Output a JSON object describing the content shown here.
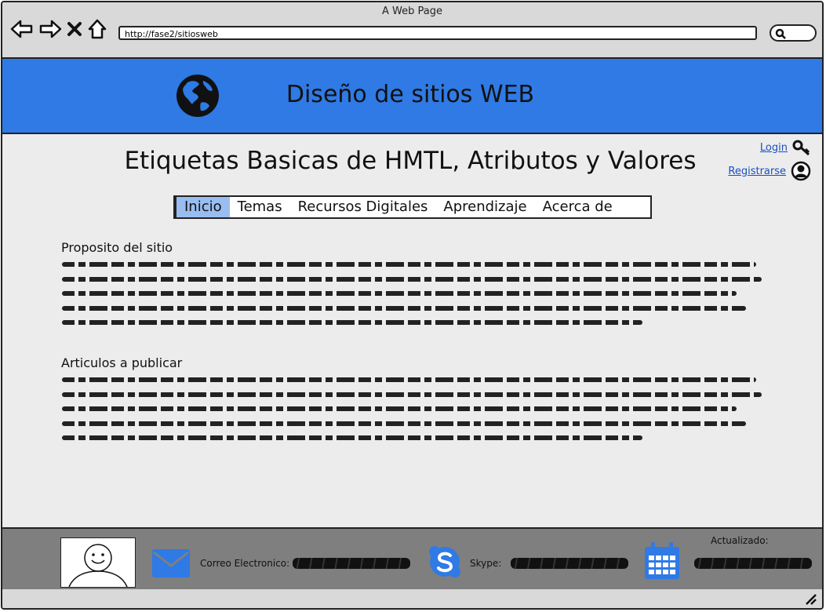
{
  "browser": {
    "window_title": "A Web Page",
    "url": "http://fase2/sitiosweb"
  },
  "header": {
    "site_title": "Diseño de sitios WEB"
  },
  "main": {
    "page_title": "Etiquetas Basicas de HMTL, Atributos y Valores",
    "auth": {
      "login_label": "Login",
      "register_label": "Registrarse"
    },
    "menu": [
      {
        "label": "Inicio",
        "active": true
      },
      {
        "label": "Temas",
        "active": false
      },
      {
        "label": "Recursos Digitales",
        "active": false
      },
      {
        "label": "Aprendizaje",
        "active": false
      },
      {
        "label": "Acerca de",
        "active": false
      }
    ],
    "sections": [
      {
        "title": "Proposito del sitio"
      },
      {
        "title": "Articulos a publicar"
      }
    ]
  },
  "footer": {
    "email_label": "Correo Electronico:",
    "skype_label": "Skype:",
    "updated_label": "Actualizado:"
  },
  "colors": {
    "header_bg": "#2f7ae5",
    "menu_active": "#99bdf0",
    "footer_bg": "#7f7f7f",
    "icon_blue": "#2f7ae5"
  }
}
